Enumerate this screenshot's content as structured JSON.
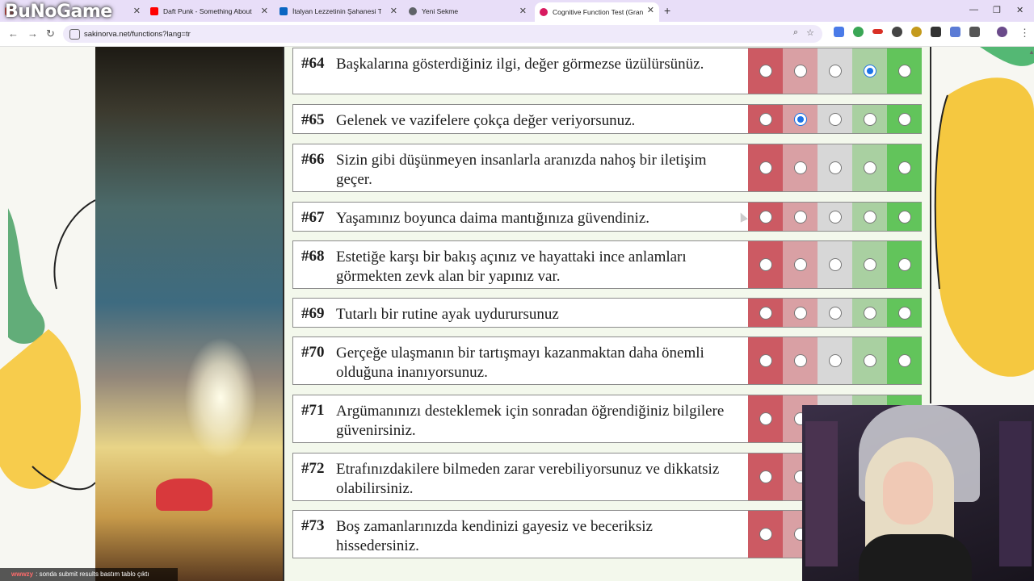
{
  "browser": {
    "tabs": [
      {
        "label": "",
        "favicon_color": "#e53935"
      },
      {
        "label": "Daft Punk - Something About U",
        "favicon_color": "#ff0000"
      },
      {
        "label": "İtalyan Lezzetinin Şahanesi Tira",
        "favicon_color": "#0a66c2"
      },
      {
        "label": "Yeni Sekme",
        "favicon_color": "#5f6368"
      },
      {
        "label": "Cognitive Function Test (Grant/",
        "favicon_color": "#d81b60"
      }
    ],
    "new_tab": "+",
    "url": "sakinorva.net/functions?lang=tr",
    "stream_logo": "BuNoGame"
  },
  "questions": [
    {
      "num": "#64",
      "text": "Başkalarına gösterdiğiniz ilgi, değer görmezse üzülürsünüz.",
      "selected": 4
    },
    {
      "num": "#65",
      "text": "Gelenek ve vazifelere çokça değer veriyorsunuz.",
      "selected": 2
    },
    {
      "num": "#66",
      "text": "Sizin gibi düşünmeyen insanlarla aranızda nahoş bir iletişim geçer.",
      "selected": 0
    },
    {
      "num": "#67",
      "text": "Yaşamınız boyunca daima mantığınıza güvendiniz.",
      "selected": 0
    },
    {
      "num": "#68",
      "text": "Estetiğe karşı bir bakış açınız ve hayattaki ince anlamları görmekten zevk alan bir yapınız var.",
      "selected": 0
    },
    {
      "num": "#69",
      "text": "Tutarlı bir rutine ayak uydurursunuz",
      "selected": 0
    },
    {
      "num": "#70",
      "text": "Gerçeğe ulaşmanın bir tartışmayı kazanmaktan daha önemli olduğuna inanıyorsunuz.",
      "selected": 0
    },
    {
      "num": "#71",
      "text": "Argümanınızı desteklemek için sonradan öğrendiğiniz bilgilere güvenirsiniz.",
      "selected": 0
    },
    {
      "num": "#72",
      "text": "Etrafınızdakilere bilmeden zarar verebiliyorsunuz ve dikkatsiz olabilirsiniz.",
      "selected": 0
    },
    {
      "num": "#73",
      "text": "Boş zamanlarınızda kendinizi gayesiz ve beceriksiz hissedersiniz.",
      "selected": 0
    }
  ],
  "chat_caption": {
    "user": "wwwzy",
    "message": ": sonda submit results bastım tablo çıktı"
  },
  "colors": {
    "strongly_disagree": "#cc5a63",
    "disagree": "#d9a0a4",
    "neutral": "#d7d7d7",
    "agree": "#a9d0a1",
    "strongly_agree": "#62c45b",
    "radio_selected": "#1a73e8"
  }
}
